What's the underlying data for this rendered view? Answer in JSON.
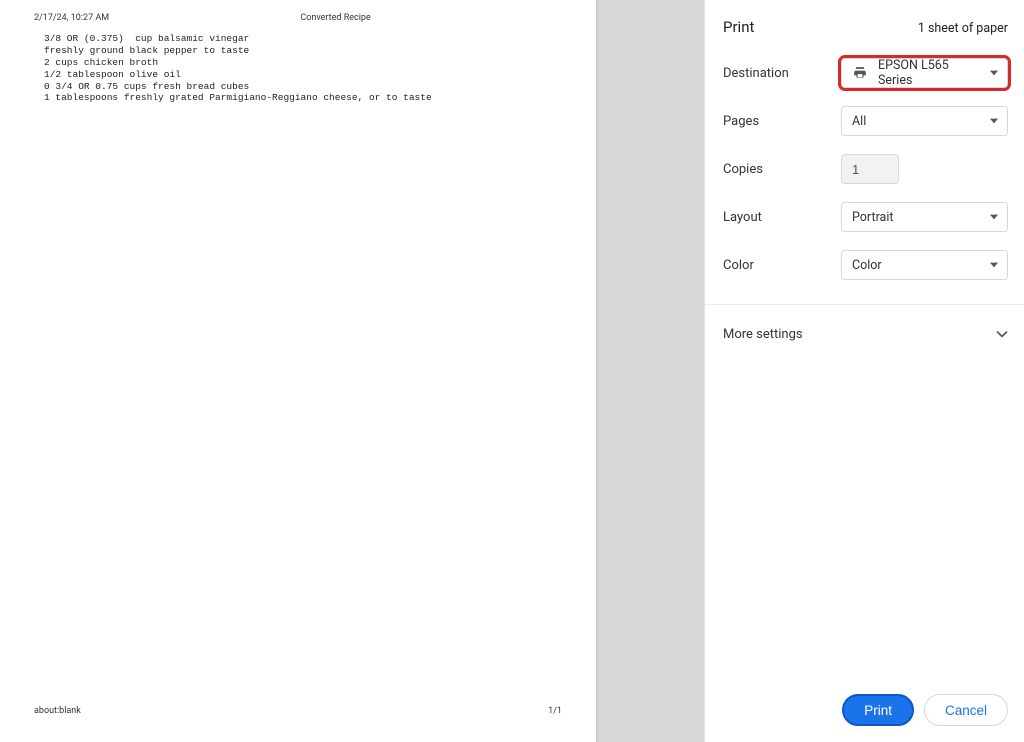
{
  "preview": {
    "timestamp": "2/17/24, 10:27 AM",
    "title": "Converted Recipe",
    "body": "3/8 OR (0.375)  cup balsamic vinegar\nfreshly ground black pepper to taste\n2 cups chicken broth\n1/2 tablespoon olive oil\n0 3/4 OR 0.75 cups fresh bread cubes\n1 tablespoons freshly grated Parmigiano-Reggiano cheese, or to taste",
    "footer_left": "about:blank",
    "footer_right": "1/1"
  },
  "panel": {
    "title": "Print",
    "sheet_count": "1 sheet of paper",
    "destination_label": "Destination",
    "destination_value": "EPSON L565 Series",
    "pages_label": "Pages",
    "pages_value": "All",
    "copies_label": "Copies",
    "copies_value": "1",
    "layout_label": "Layout",
    "layout_value": "Portrait",
    "color_label": "Color",
    "color_value": "Color",
    "more_label": "More settings",
    "print_btn": "Print",
    "cancel_btn": "Cancel"
  }
}
